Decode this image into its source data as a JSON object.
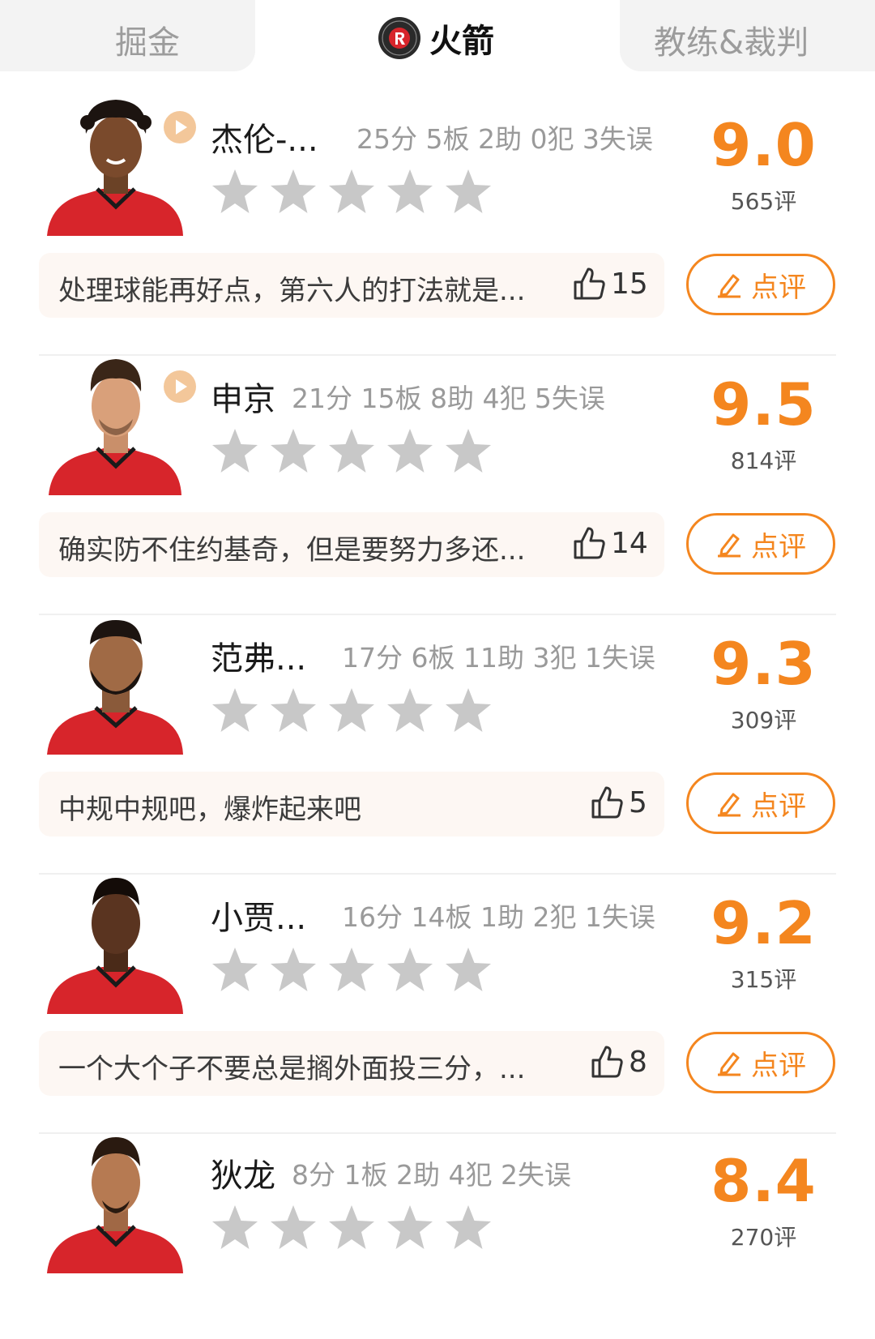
{
  "tabs": [
    {
      "label": "掘金",
      "active": false
    },
    {
      "label": "火箭",
      "active": true,
      "icon": "rockets-logo-icon"
    },
    {
      "label": "教练&裁判",
      "active": false
    }
  ],
  "colors": {
    "accent": "#f4861f",
    "jersey": "#d7252b",
    "star": "#c8c8c8",
    "comment_bg": "#fdf7f3"
  },
  "review_label": "点评",
  "players": [
    {
      "name": "杰伦-...",
      "stats": "25分 5板 2助 0犯 3失误",
      "rating": "9.0",
      "count": "565评",
      "stars_filled": 0,
      "has_video": true,
      "comment": "处理球能再好点，第六人的打法就是...",
      "likes": "15"
    },
    {
      "name": "申京",
      "stats": "21分 15板 8助 4犯 5失误",
      "rating": "9.5",
      "count": "814评",
      "stars_filled": 0,
      "has_video": true,
      "comment": "确实防不住约基奇，但是要努力多还...",
      "likes": "14"
    },
    {
      "name": "范弗...",
      "stats": "17分 6板 11助 3犯 1失误",
      "rating": "9.3",
      "count": "309评",
      "stars_filled": 0,
      "has_video": false,
      "comment": "中规中规吧，爆炸起来吧",
      "likes": "5"
    },
    {
      "name": "小贾...",
      "stats": "16分 14板 1助 2犯 1失误",
      "rating": "9.2",
      "count": "315评",
      "stars_filled": 0,
      "has_video": false,
      "comment": "一个大个子不要总是搁外面投三分，...",
      "likes": "8"
    },
    {
      "name": "狄龙",
      "stats": "8分 1板 2助 4犯 2失误",
      "rating": "8.4",
      "count": "270评",
      "stars_filled": 0,
      "has_video": false
    }
  ]
}
